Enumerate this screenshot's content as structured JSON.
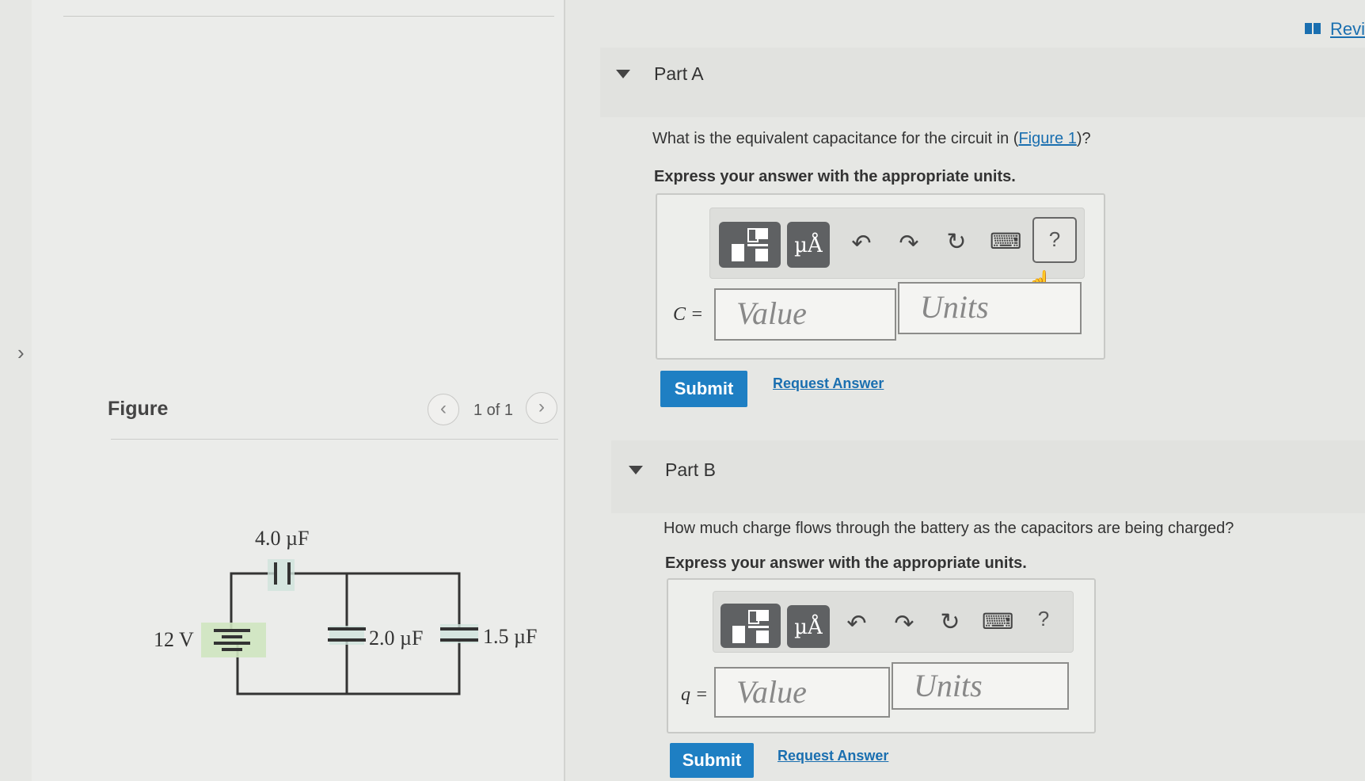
{
  "header": {
    "review_link": "Revi",
    "review_icon": "book-icon"
  },
  "figure_panel": {
    "title": "Figure",
    "pager": "1 of 1",
    "prev_icon": "chevron-left-icon",
    "next_icon": "chevron-right-icon",
    "circuit": {
      "battery_label": "12 V",
      "c_series_label": "4.0 µF",
      "c_middle_label": "2.0 µF",
      "c_right_label": "1.5 µF"
    }
  },
  "part_a": {
    "title": "Part A",
    "question_prefix": "What is the equivalent capacitance for the circuit in (",
    "figure_link": "Figure 1",
    "question_suffix": ")?",
    "instruction": "Express your answer with the appropriate units.",
    "variable": "C =",
    "value_placeholder": "Value",
    "units_placeholder": "Units",
    "submit": "Submit",
    "request_answer": "Request Answer"
  },
  "part_b": {
    "title": "Part B",
    "question": "How much charge flows through the battery as the capacitors are being charged?",
    "instruction": "Express your answer with the appropriate units.",
    "variable": "q =",
    "value_placeholder": "Value",
    "units_placeholder": "Units",
    "submit": "Submit",
    "request_answer": "Request Answer"
  },
  "toolbar": {
    "templates_icon": "templates-icon",
    "units_button": "µÅ",
    "undo_icon": "undo-icon",
    "redo_icon": "redo-icon",
    "reset_icon": "reset-icon",
    "keyboard_icon": "keyboard-icon",
    "help": "?"
  },
  "colors": {
    "link": "#1a6fb0",
    "submit": "#1e7fc3",
    "toolbar_button": "#5f6163"
  }
}
